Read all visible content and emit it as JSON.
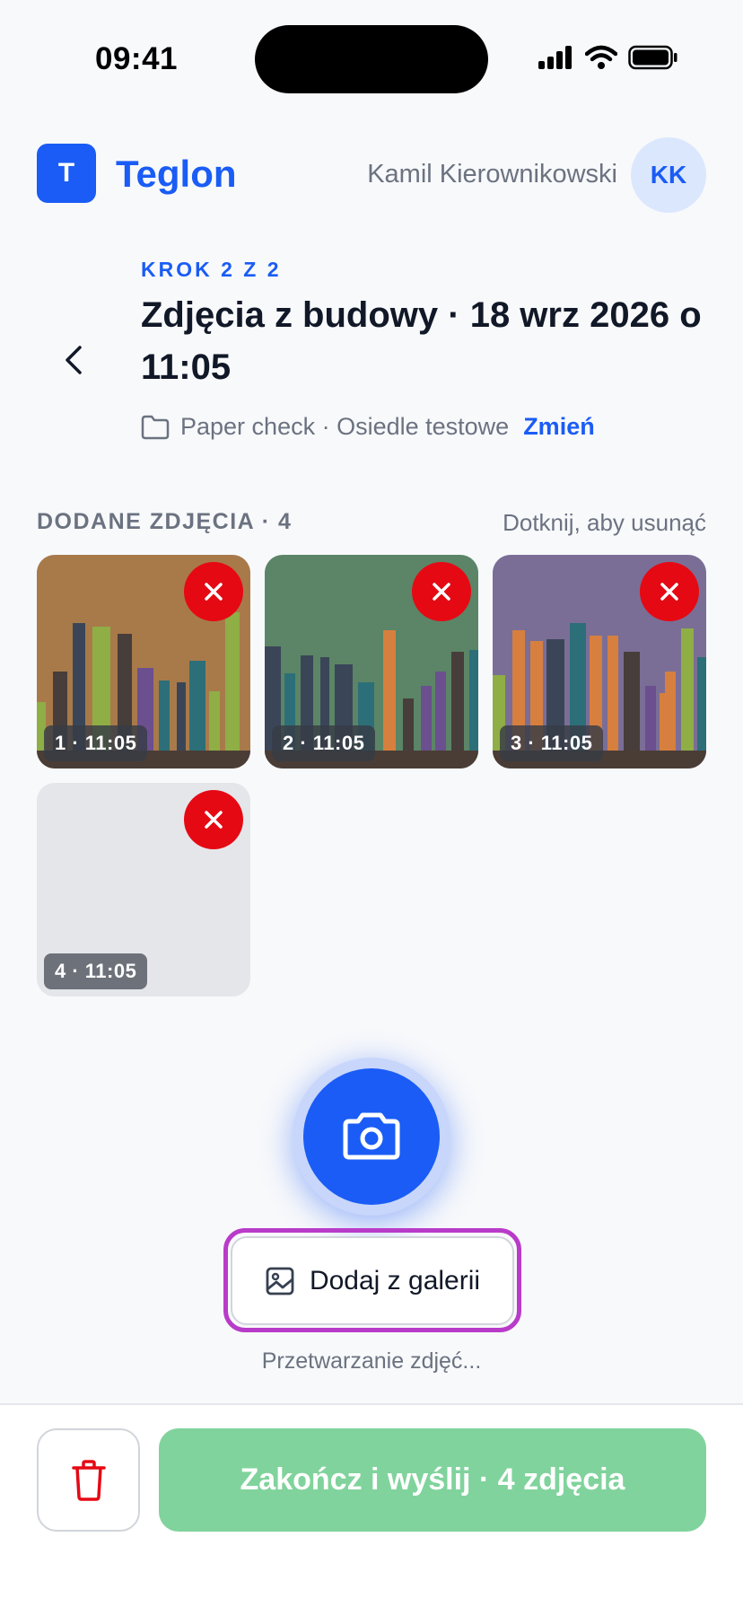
{
  "status_bar": {
    "time": "09:41"
  },
  "header": {
    "app_logo_letter": "T",
    "app_name": "Teglon",
    "user_name": "Kamil Kierownikowski",
    "avatar_initials": "KK"
  },
  "step": {
    "label": "KROK 2 Z 2",
    "title": "Zdjęcia z budowy · 18 wrz 2026 o 11:05",
    "project": "Paper check · Osiedle testowe",
    "change_link": "Zmień"
  },
  "photos": {
    "heading": "DODANE ZDJĘCIA · 4",
    "hint": "Dotknij, aby usunąć",
    "items": [
      {
        "label": "1 · 11:05",
        "bg": "#a87a4a"
      },
      {
        "label": "2 · 11:05",
        "bg": "#5b8566"
      },
      {
        "label": "3 · 11:05",
        "bg": "#7a6e96"
      },
      {
        "label": "4 · 11:05",
        "bg": "#e5e6ea"
      }
    ]
  },
  "gallery_button_label": "Dodaj z galerii",
  "processing_text": "Przetwarzanie zdjęć...",
  "submit_button_label": "Zakończ i wyślij · 4 zdjęcia",
  "colors": {
    "accent": "#1a5cf5",
    "danger": "#e50914",
    "submit": "#80d39c",
    "highlight": "#b93bc9"
  }
}
